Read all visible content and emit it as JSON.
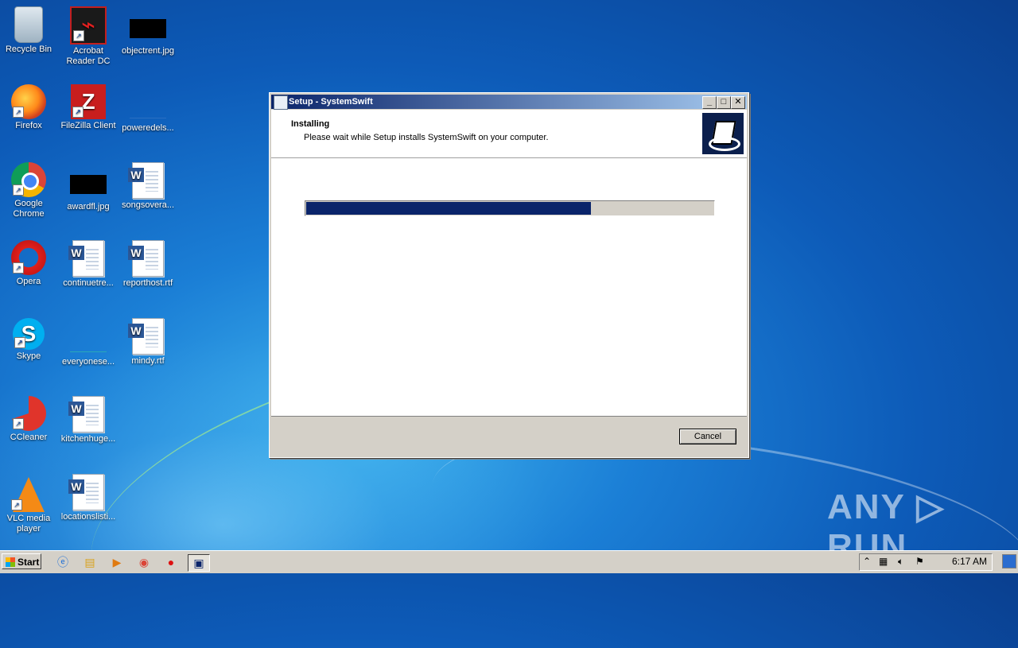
{
  "desktop": {
    "icons": [
      {
        "label": "Recycle Bin"
      },
      {
        "label": "Acrobat Reader DC"
      },
      {
        "label": "objectrent.jpg"
      },
      {
        "label": "Firefox"
      },
      {
        "label": "FileZilla Client"
      },
      {
        "label": "poweredels..."
      },
      {
        "label": "Google Chrome"
      },
      {
        "label": "awardfl.jpg"
      },
      {
        "label": "songsovera..."
      },
      {
        "label": "Opera"
      },
      {
        "label": "continuetre..."
      },
      {
        "label": "reporthost.rtf"
      },
      {
        "label": "Skype"
      },
      {
        "label": "everyonese..."
      },
      {
        "label": "mindy.rtf"
      },
      {
        "label": "CCleaner"
      },
      {
        "label": "kitchenhuge..."
      },
      {
        "label": "VLC media player"
      },
      {
        "label": "locationslisti..."
      }
    ]
  },
  "window": {
    "title": "Setup - SystemSwift",
    "heading": "Installing",
    "subheading": "Please wait while Setup installs SystemSwift on your computer.",
    "progress_fraction": 0.7,
    "cancel_label": "Cancel",
    "buttons": {
      "minimize": "_",
      "maximize": "□",
      "close": "✕"
    }
  },
  "taskbar": {
    "start_label": "Start",
    "pinned": [
      "ie-icon",
      "explorer-icon",
      "media-player-icon",
      "chrome-icon",
      "opera-icon",
      "setup-icon"
    ],
    "clock": "6:17 AM"
  },
  "watermark": "ANY ▷ RUN",
  "colors": {
    "title_active": "#0a246a",
    "progress": "#0a246a"
  }
}
